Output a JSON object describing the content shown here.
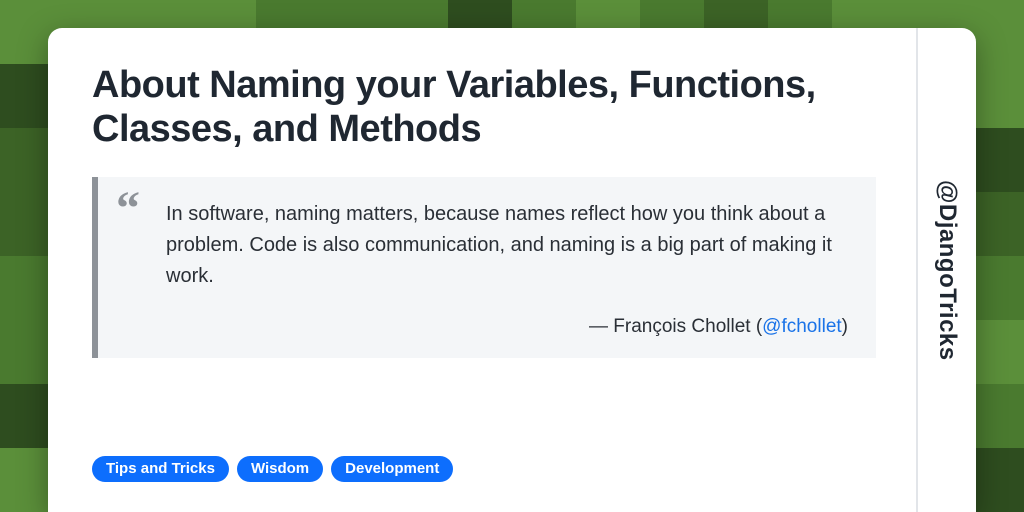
{
  "title": "About Naming your Variables, Functions, Classes, and Methods",
  "quote": {
    "text": "In software, naming matters, because names reflect how you think about a problem. Code is also communication, and naming is a big part of making it work.",
    "author_prefix": "— François Chollet (",
    "author_handle": "@fchollet",
    "author_suffix": ")"
  },
  "tags": [
    "Tips and Tricks",
    "Wisdom",
    "Development"
  ],
  "account_handle": "@DjangoTricks"
}
